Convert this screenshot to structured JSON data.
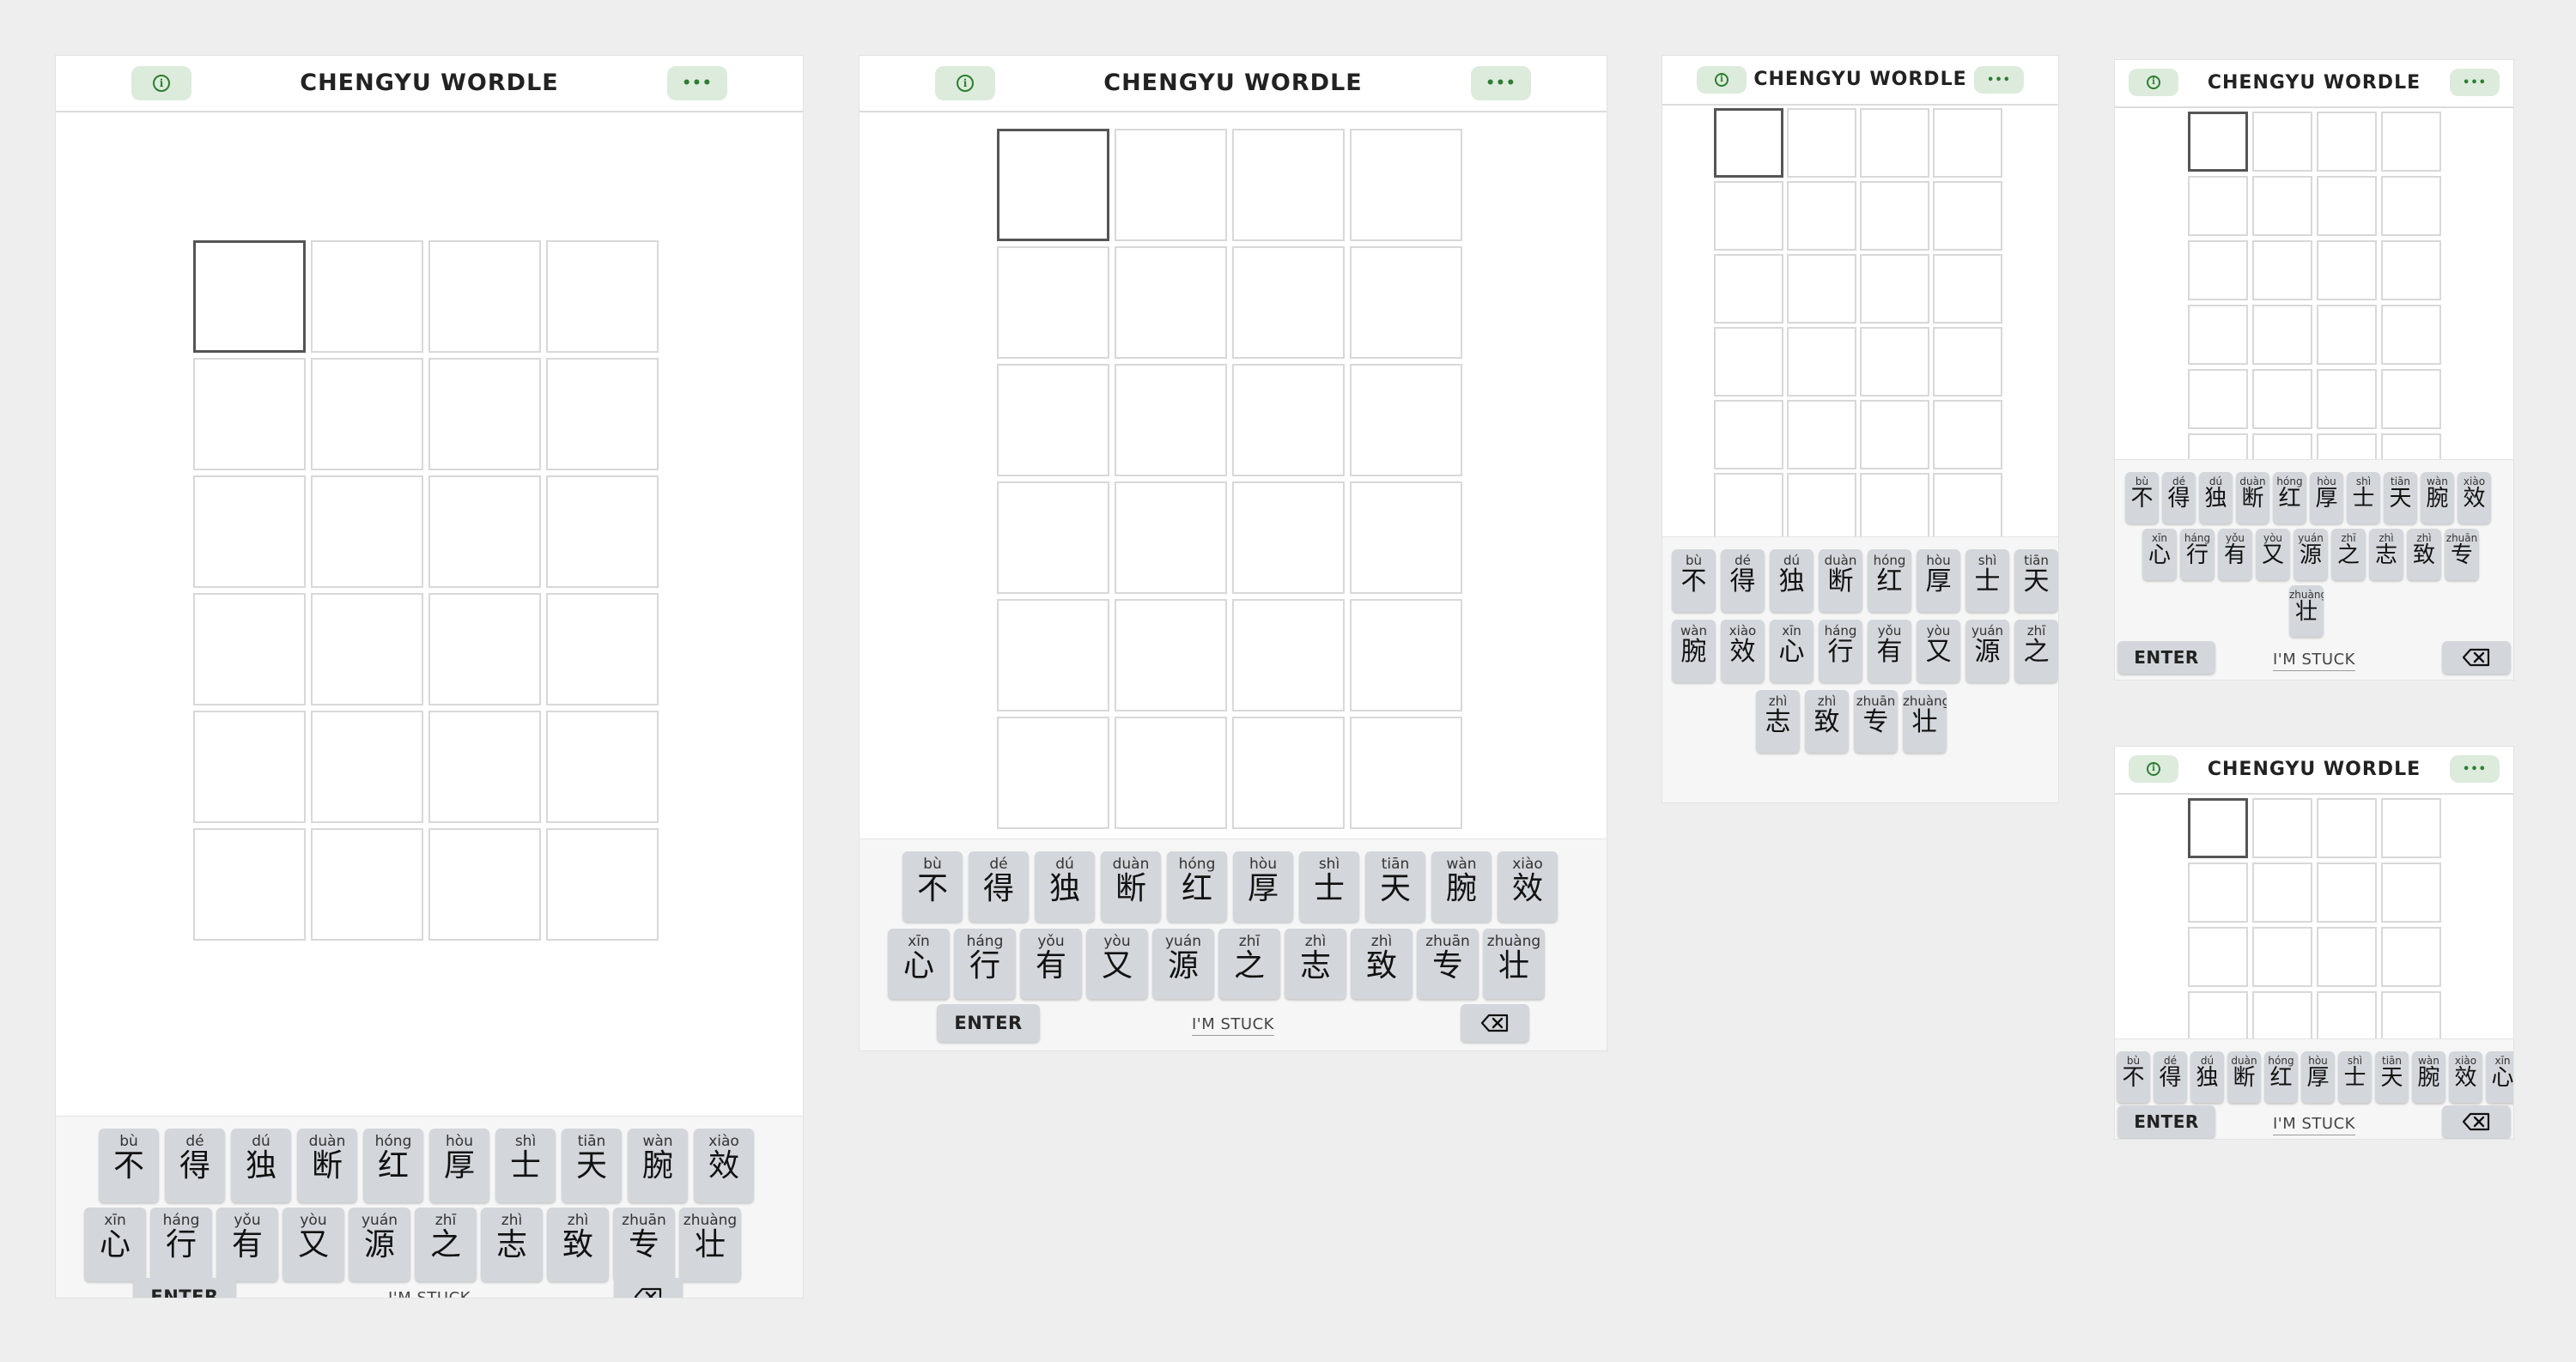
{
  "app": {
    "title": "CHENGYU WORDLE",
    "info_icon": "info-icon",
    "menu_icon": "more-dots-icon",
    "menu_glyph": "•••",
    "info_glyph": "i",
    "enter_label": "ENTER",
    "stuck_label": "I'M STUCK",
    "backspace_icon": "backspace-icon",
    "accent_color": "#2e7d32",
    "header_button_color": "#dcebdc",
    "key_color": "#d3d6da"
  },
  "grid": {
    "rows": 6,
    "cols": 4
  },
  "keys": [
    {
      "py": "bù",
      "ch": "不"
    },
    {
      "py": "dé",
      "ch": "得"
    },
    {
      "py": "dú",
      "ch": "独"
    },
    {
      "py": "duàn",
      "ch": "断"
    },
    {
      "py": "hóng",
      "ch": "红"
    },
    {
      "py": "hòu",
      "ch": "厚"
    },
    {
      "py": "shì",
      "ch": "士"
    },
    {
      "py": "tiān",
      "ch": "天"
    },
    {
      "py": "wàn",
      "ch": "腕"
    },
    {
      "py": "xiào",
      "ch": "效"
    },
    {
      "py": "xīn",
      "ch": "心"
    },
    {
      "py": "háng",
      "ch": "行"
    },
    {
      "py": "yǒu",
      "ch": "有"
    },
    {
      "py": "yòu",
      "ch": "又"
    },
    {
      "py": "yuán",
      "ch": "源"
    },
    {
      "py": "zhī",
      "ch": "之"
    },
    {
      "py": "zhì",
      "ch": "志"
    },
    {
      "py": "zhì",
      "ch": "致"
    },
    {
      "py": "zhuān",
      "ch": "专"
    },
    {
      "py": "zhuàng",
      "ch": "壮"
    }
  ]
}
